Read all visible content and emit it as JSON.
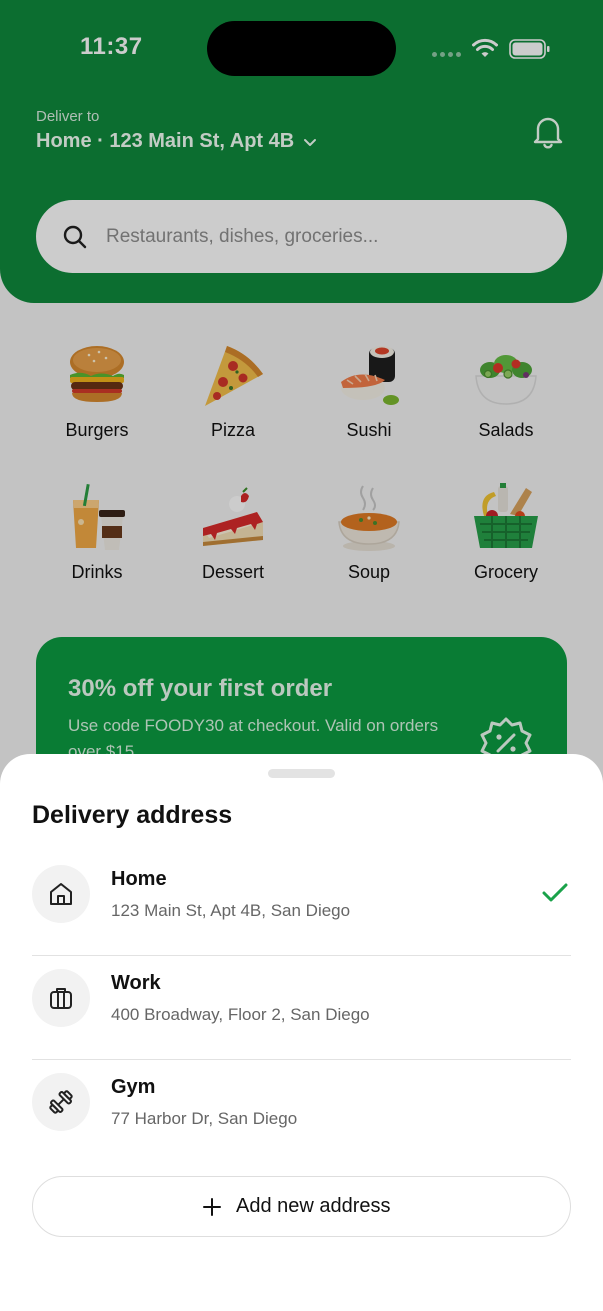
{
  "status_bar": {
    "time": "11:37"
  },
  "header": {
    "deliver_label": "Deliver to",
    "address_title": "Home · 123 Main St, Apt 4B"
  },
  "search": {
    "placeholder": "Restaurants, dishes, groceries..."
  },
  "categories": [
    {
      "label": "Burgers",
      "icon": "burger-icon"
    },
    {
      "label": "Pizza",
      "icon": "pizza-icon"
    },
    {
      "label": "Sushi",
      "icon": "sushi-icon"
    },
    {
      "label": "Salads",
      "icon": "salad-icon"
    },
    {
      "label": "Drinks",
      "icon": "drinks-icon"
    },
    {
      "label": "Dessert",
      "icon": "dessert-icon"
    },
    {
      "label": "Soup",
      "icon": "soup-icon"
    },
    {
      "label": "Grocery",
      "icon": "grocery-icon"
    }
  ],
  "promo": {
    "title": "30% off your first order",
    "subtitle": "Use code FOODY30 at checkout. Valid on orders over $15"
  },
  "sheet": {
    "title": "Delivery address",
    "addresses": [
      {
        "name": "Home",
        "line": "123 Main St, Apt 4B, San Diego",
        "icon": "home-icon",
        "selected": true
      },
      {
        "name": "Work",
        "line": "400 Broadway, Floor 2, San Diego",
        "icon": "briefcase-icon",
        "selected": false
      },
      {
        "name": "Gym",
        "line": "77 Harbor Dr, San Diego",
        "icon": "dumbbell-icon",
        "selected": false
      }
    ],
    "add_label": "Add new address"
  },
  "colors": {
    "brand_green": "#0f8a3c",
    "promo_green": "#0c9b41",
    "check_green": "#1aa24a"
  }
}
